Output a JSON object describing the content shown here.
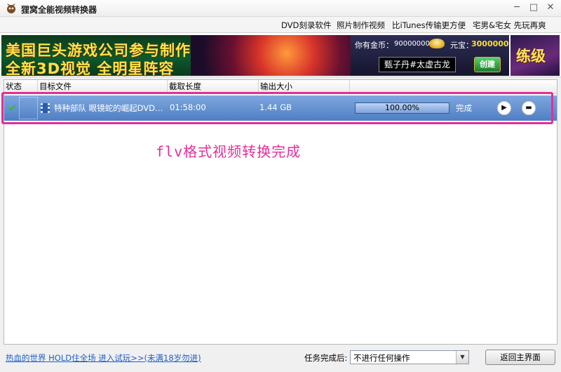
{
  "window": {
    "title": "狸窝全能视频转换器",
    "controls": {
      "minimize": "─",
      "maximize": "□",
      "close": "✕"
    }
  },
  "top_links": [
    "DVD刻录软件",
    "照片制作视频",
    "比iTunes传输更方便",
    "宅男&宅女 先玩再爽"
  ],
  "banner": {
    "line1": "美国巨头游戏公司参与制作",
    "line2": "全新3D视觉 全明星阵容",
    "money_label": "你有金币：",
    "money_value": "90000000",
    "yuanbao_label": "元宝：",
    "yuanbao_value": "3000000",
    "character_name": "甄子丹#太虚古龙",
    "create_button": "创建",
    "side_text": "练级"
  },
  "table": {
    "headers": [
      "状态",
      "目标文件",
      "截取长度",
      "输出大小"
    ],
    "rows": [
      {
        "status_icon": "checkmark-icon",
        "filename": "特种部队 眼镜蛇的崛起DVD…",
        "duration": "01:58:00",
        "size": "1.44 GB",
        "progress": 100,
        "progress_text": "100.00%",
        "state": "完成"
      }
    ]
  },
  "annotation": "flv格式视频转换完成",
  "footer": {
    "ad_link": "热血的世界 HOLD住全场 进入试玩>>(未满18岁勿进)",
    "after_label": "任务完成后:",
    "after_select": "不进行任何操作",
    "main_button": "返回主界面"
  },
  "colors": {
    "row_highlight": "#4f7fc4",
    "annotation": "#e52d9a",
    "link": "#1e5fc8"
  }
}
